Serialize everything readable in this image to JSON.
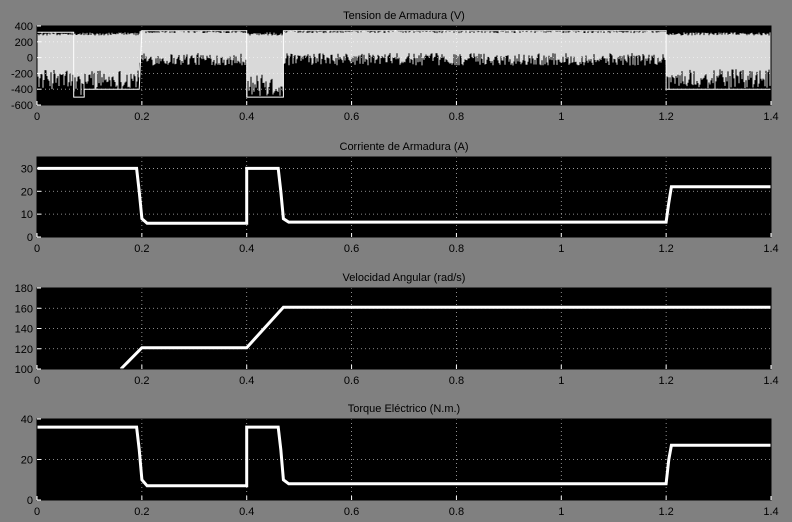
{
  "colors": {
    "background": "#808080",
    "plot_area": "#000000",
    "trace": "#ffffff",
    "grid": "#ffffff",
    "text": "#000000"
  },
  "chart_data": [
    {
      "type": "line",
      "title": "Tension de Armadura (V)",
      "xlabel": "",
      "ylabel": "",
      "xlim": [
        0,
        1.4
      ],
      "ylim": [
        -600,
        400
      ],
      "x_ticks": [
        0,
        0.2,
        0.4,
        0.6,
        0.8,
        1,
        1.2,
        1.4
      ],
      "y_ticks": [
        -600,
        -400,
        -200,
        0,
        200,
        400
      ],
      "grid": true,
      "envelope": {
        "x": [
          0,
          0.07,
          0.07,
          0.09,
          0.09,
          0.195,
          0.195,
          0.4,
          0.4,
          0.47,
          0.47,
          1.2,
          1.2,
          1.4
        ],
        "upper": [
          320,
          320,
          320,
          320,
          320,
          320,
          350,
          350,
          320,
          320,
          350,
          350,
          320,
          320
        ],
        "lower": [
          -400,
          -400,
          -500,
          -500,
          -400,
          -400,
          -100,
          -100,
          -500,
          -500,
          -100,
          -100,
          -400,
          -400
        ]
      },
      "series": [
        {
          "x": [
            0,
            0.07,
            0.07,
            0.09,
            0.09,
            0.195,
            0.2,
            0.4,
            0.4,
            0.47,
            0.47,
            1.2,
            1.2,
            1.4
          ],
          "values": [
            320,
            320,
            -500,
            -500,
            -400,
            -400,
            340,
            340,
            -500,
            -500,
            340,
            340,
            -400,
            -400
          ]
        }
      ]
    },
    {
      "type": "line",
      "title": "Corriente de Armadura (A)",
      "xlabel": "",
      "ylabel": "",
      "xlim": [
        0,
        1.4
      ],
      "ylim": [
        0,
        35
      ],
      "x_ticks": [
        0,
        0.2,
        0.4,
        0.6,
        0.8,
        1,
        1.2,
        1.4
      ],
      "y_ticks": [
        0,
        10,
        20,
        30
      ],
      "grid": true,
      "series": [
        {
          "x": [
            0,
            0.19,
            0.195,
            0.2,
            0.21,
            0.4,
            0.4,
            0.46,
            0.465,
            0.47,
            0.48,
            1.2,
            1.205,
            1.21,
            1.4
          ],
          "values": [
            30,
            30,
            20,
            8,
            6,
            6,
            30,
            30,
            20,
            8,
            6.5,
            6.5,
            15,
            22,
            22
          ]
        }
      ]
    },
    {
      "type": "line",
      "title": "Velocidad Angular (rad/s)",
      "xlabel": "",
      "ylabel": "",
      "xlim": [
        0,
        1.4
      ],
      "ylim": [
        100,
        180
      ],
      "x_ticks": [
        0,
        0.2,
        0.4,
        0.6,
        0.8,
        1,
        1.2,
        1.4
      ],
      "y_ticks": [
        100,
        120,
        140,
        160,
        180
      ],
      "grid": true,
      "series": [
        {
          "x": [
            0.16,
            0.2,
            0.4,
            0.47,
            1.4
          ],
          "values": [
            100,
            121,
            121,
            161,
            161
          ]
        }
      ]
    },
    {
      "type": "line",
      "title": "Torque Eléctrico (N.m.)",
      "xlabel": "",
      "ylabel": "",
      "xlim": [
        0,
        1.4
      ],
      "ylim": [
        0,
        40
      ],
      "x_ticks": [
        0,
        0.2,
        0.4,
        0.6,
        0.8,
        1,
        1.2,
        1.4
      ],
      "y_ticks": [
        0,
        20,
        40
      ],
      "grid": true,
      "series": [
        {
          "x": [
            0,
            0.19,
            0.195,
            0.2,
            0.21,
            0.4,
            0.4,
            0.46,
            0.465,
            0.47,
            0.48,
            1.2,
            1.205,
            1.21,
            1.4
          ],
          "values": [
            36,
            36,
            25,
            10,
            7,
            7,
            36,
            36,
            25,
            10,
            8,
            8,
            20,
            27,
            27
          ]
        }
      ]
    }
  ]
}
